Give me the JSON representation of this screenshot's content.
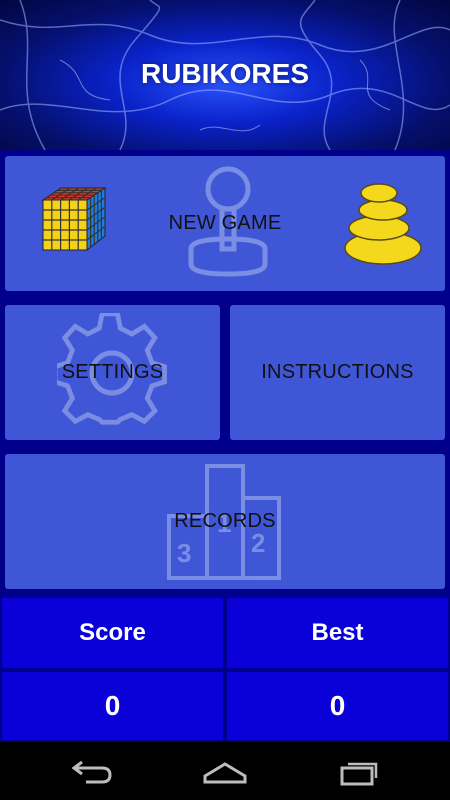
{
  "app": {
    "title": "RUBIKORES"
  },
  "menu": {
    "new_game": "NEW GAME",
    "settings": "SETTINGS",
    "instructions": "INSTRUCTIONS",
    "records": "RECORDS"
  },
  "scores": {
    "score_label": "Score",
    "best_label": "Best",
    "score_value": "0",
    "best_value": "0"
  },
  "icons": {
    "cube": "rubiks-cube-icon",
    "joystick": "joystick-icon",
    "stones": "stacked-stones-icon",
    "gear": "gear-icon",
    "podium": "podium-icon",
    "back": "back-icon",
    "home": "home-icon",
    "recent": "recent-apps-icon"
  },
  "colors": {
    "tile": "#3f57d6",
    "score_cell": "#0a00d8",
    "background": "#00008c",
    "stones": "#f4d81c"
  }
}
